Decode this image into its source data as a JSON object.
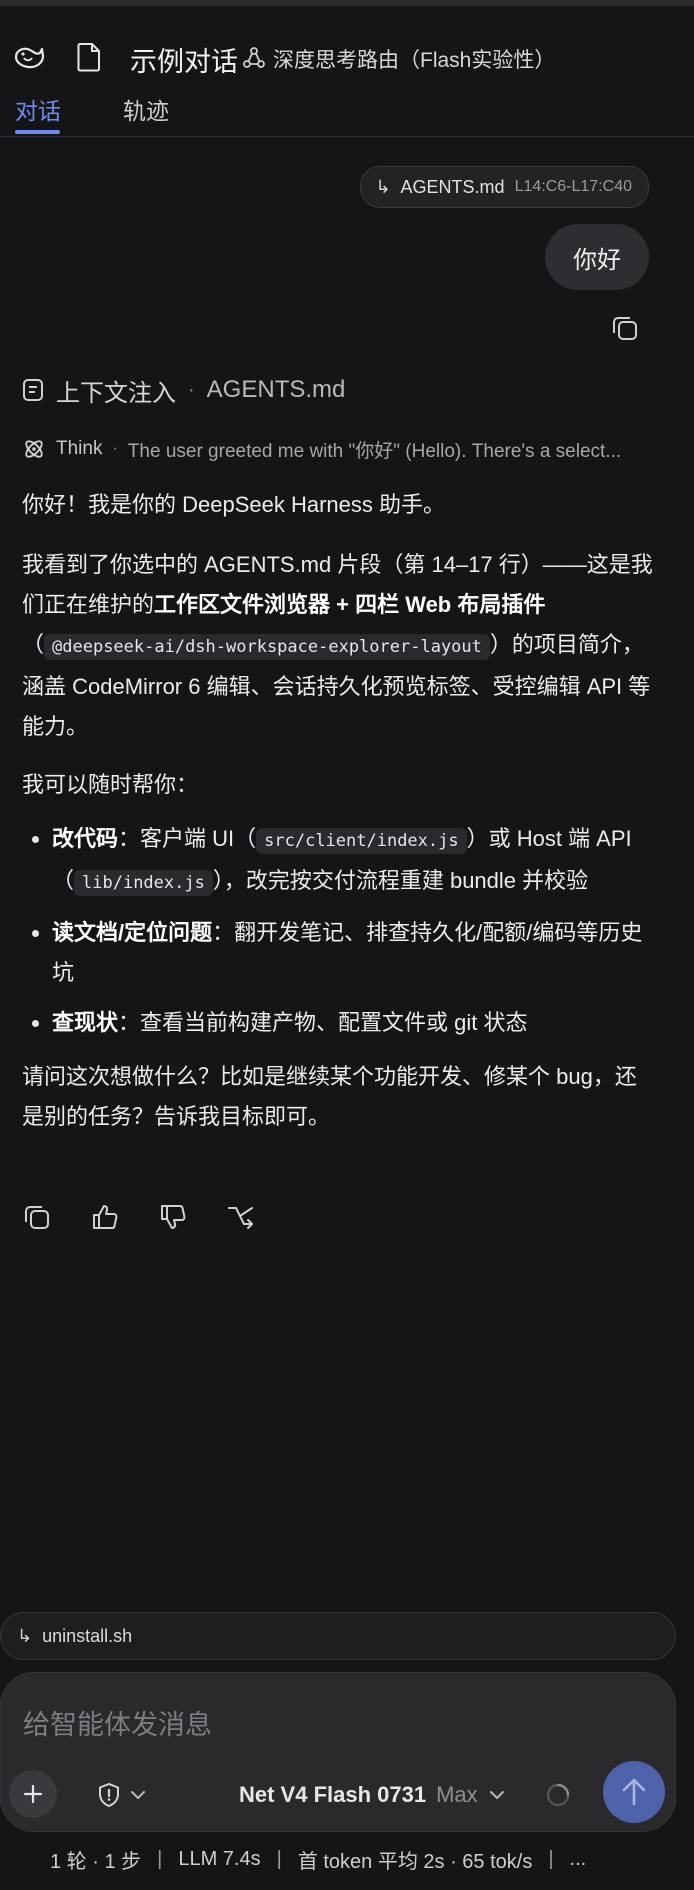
{
  "header": {
    "title": "示例对话",
    "route_label": "深度思考路由（Flash实验性）",
    "tabs": [
      {
        "label": "对话",
        "active": true
      },
      {
        "label": "轨迹",
        "active": false
      }
    ]
  },
  "colors": {
    "accent": "#6d8df2",
    "background": "#151517",
    "send_button": "#4d62a8"
  },
  "user_message": {
    "reference_file": "AGENTS.md",
    "reference_range": "L14:C6-L17:C40",
    "text": "你好"
  },
  "assistant": {
    "context_label": "上下文注入",
    "context_file": "AGENTS.md",
    "think_label": "Think",
    "think_summary": "The user greeted me with \"你好\" (Hello). There's a select...",
    "p1": "你好！我是你的 DeepSeek Harness 助手。",
    "p2_a": "我看到了你选中的 AGENTS.md 片段（第 14–17 行）——这是我们正在维护的",
    "p2_b": "工作区文件浏览器 + 四栏 Web 布局插件",
    "p2_c": "（",
    "p2_code": "@deepseek-ai/dsh-workspace-explorer-layout",
    "p2_d": "）的项目简介，涵盖 CodeMirror 6 编辑、会话持久化预览标签、受控编辑 API 等能力。",
    "p3": "我可以随时帮你：",
    "bullets": [
      {
        "title": "改代码",
        "a": "：客户端 UI（",
        "code1": "src/client/index.js",
        "b": "）或 Host 端 API（",
        "code2": "lib/index.js",
        "c": "），改完按交付流程重建 bundle 并校验"
      },
      {
        "title": "读文档/定位问题",
        "a": "：翻开发笔记、排查持久化/配额/编码等历史坑"
      },
      {
        "title": "查现状",
        "a": "：查看当前构建产物、配置文件或 git 状态"
      }
    ],
    "p4": "请问这次想做什么？比如是继续某个功能开发、修某个 bug，还是别的任务？告诉我目标即可。",
    "actions": [
      "copy-icon",
      "thumbs-up-icon",
      "thumbs-down-icon",
      "branch-icon"
    ]
  },
  "composer": {
    "attachment_file": "uninstall.sh",
    "placeholder": "给智能体发消息",
    "model_name": "Net V4 Flash 0731",
    "model_mode": "Max"
  },
  "status_bar": {
    "rounds": "1 轮 · 1 步",
    "llm": "LLM 7.4s",
    "token": "首 token 平均 2s · 65 tok/s",
    "more": "..."
  }
}
